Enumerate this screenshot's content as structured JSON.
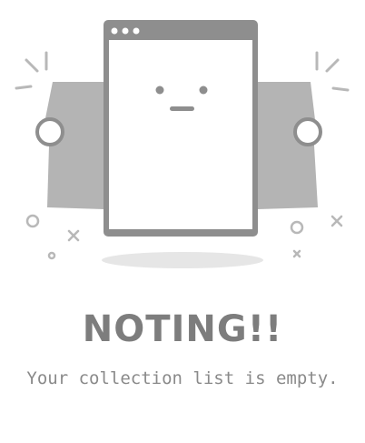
{
  "empty_state": {
    "illustration_icon": "empty-browser-window-icon",
    "title": "NOTING!!",
    "message": "Your collection list is empty.",
    "colors": {
      "window_frame": "#8e8e8e",
      "side_panels": "#b4b4b4",
      "shadow": "#e6e6e6",
      "text_title": "#7d7d7d",
      "text_message": "#8a8a8a"
    }
  }
}
